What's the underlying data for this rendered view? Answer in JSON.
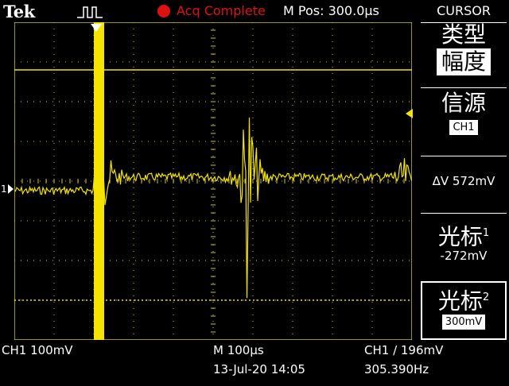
{
  "header": {
    "brand": "Tek",
    "acq_status": "Acq Complete",
    "m_pos": "M Pos: 300.0µs"
  },
  "side_menu": {
    "title": "CURSOR",
    "type_label": "类型",
    "type_value": "幅度",
    "source_label": "信源",
    "source_value": "CH1",
    "delta": "ΔV 572mV",
    "cursor1_label": "光标",
    "cursor1_sub": "1",
    "cursor1_value": "-272mV",
    "cursor2_label": "光标",
    "cursor2_sub": "2",
    "cursor2_value": "300mV"
  },
  "status_bar": {
    "ch1_scale": "CH1  100mV",
    "timebase": "M 100µs",
    "datetime": "13-Jul-20 14:05",
    "trigger": "CH1 ∕ 196mV",
    "frequency": "305.390Hz"
  },
  "markers": {
    "channel": "1",
    "trigger_arrow": "T"
  },
  "colors": {
    "trace": "#f5e400",
    "grid": "#cfc900",
    "acq": "#e01010",
    "background": "#000000"
  }
}
